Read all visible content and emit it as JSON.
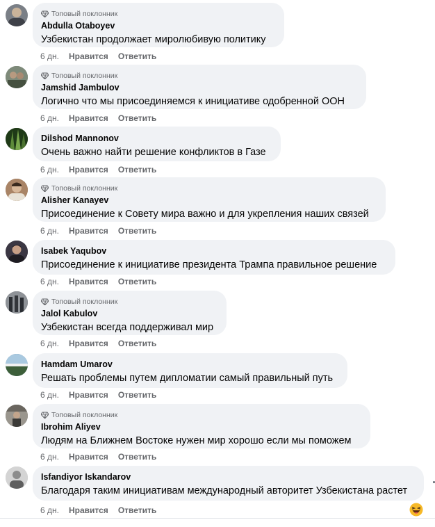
{
  "labels": {
    "time": "6 дн.",
    "like": "Нравится",
    "reply": "Ответить",
    "badge": "Топовый поклонник"
  },
  "comments": [
    {
      "author": "Abdulla Otaboyev",
      "text": "Узбекистан продолжает миролюбивую политику",
      "badge": true,
      "avatar_color": "#7a7f86"
    },
    {
      "author": "Jamshid Jambulov",
      "text": "Логично что мы присоединяемся к инициативе одобренной ООН",
      "badge": true,
      "avatar_color": "#5c6a5a"
    },
    {
      "author": "Dilshod Mannonov",
      "text": "Очень важно найти решение конфликтов в Газе",
      "badge": false,
      "avatar_color": "#2e4d22"
    },
    {
      "author": "Alisher Kanayev",
      "text": "Присоединение к Совету мира важно и для укрепления наших связей",
      "badge": true,
      "avatar_color": "#8a6a4e"
    },
    {
      "author": "Isabek Yaqubov",
      "text": "Присоединение к инициативе президента Трампа правильное решение",
      "badge": false,
      "avatar_color": "#2d2a33"
    },
    {
      "author": "Jalol Kabulov",
      "text": "Узбекистан всегда поддерживал мир",
      "badge": true,
      "avatar_color": "#4b4f55"
    },
    {
      "author": "Hamdam Umarov",
      "text": "Решать проблемы путем дипломатии самый правильный путь",
      "badge": false,
      "avatar_color": "#3f6d8c"
    },
    {
      "author": "Ibrohim Aliyev",
      "text": "Людям на Ближнем Востоке нужен мир хорошо если мы поможем",
      "badge": true,
      "avatar_color": "#6e6a63"
    },
    {
      "author": "Isfandiyor Iskandarov",
      "text": "Благодаря таким инициативам международный авторитет Узбекистана растет",
      "badge": false,
      "avatar_color": "#b9b9b9"
    }
  ]
}
